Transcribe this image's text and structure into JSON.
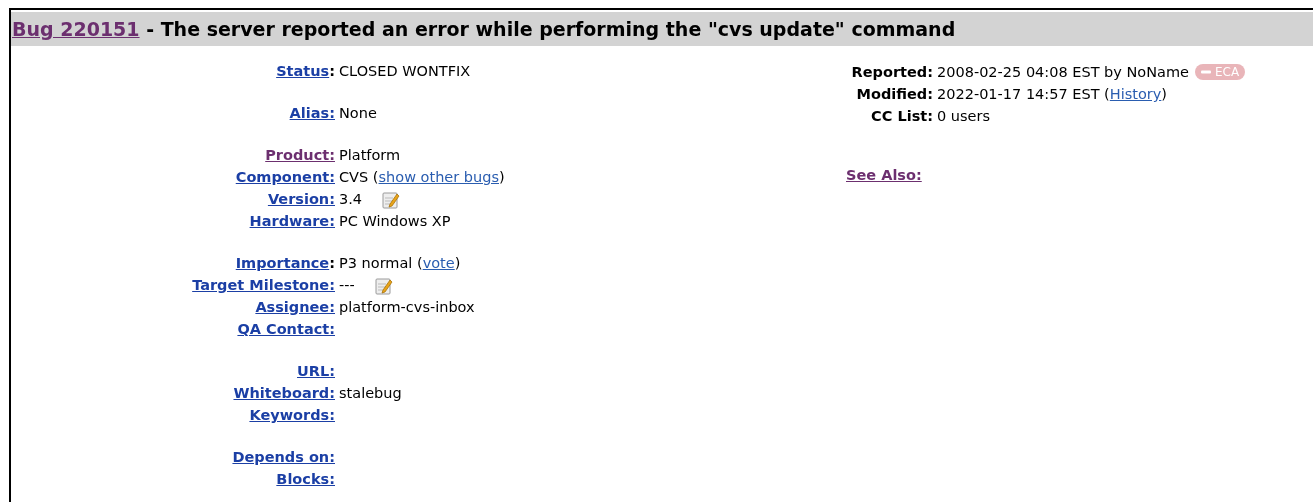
{
  "header": {
    "bug_link": "Bug 220151",
    "title": " - The server reported an error while performing the \"cvs update\" command"
  },
  "fields": [
    [
      {
        "label": "Status",
        "label_suffix": ":",
        "visited": false,
        "value": [
          {
            "kind": "text",
            "text": "CLOSED WONTFIX"
          }
        ]
      }
    ],
    [
      {
        "label": "Alias:",
        "visited": false,
        "value": [
          {
            "kind": "text",
            "text": "None"
          }
        ]
      }
    ],
    [
      {
        "label": "Product:",
        "visited": true,
        "value": [
          {
            "kind": "text",
            "text": "Platform"
          }
        ]
      },
      {
        "label": "Component:",
        "visited": false,
        "value": [
          {
            "kind": "text",
            "text": "CVS ("
          },
          {
            "kind": "link",
            "text": "show other bugs"
          },
          {
            "kind": "text",
            "text": ")"
          }
        ]
      },
      {
        "label": "Version:",
        "visited": false,
        "value": [
          {
            "kind": "text",
            "text": "3.4"
          },
          {
            "kind": "edit"
          }
        ]
      },
      {
        "label": "Hardware:",
        "visited": false,
        "value": [
          {
            "kind": "text",
            "text": "PC Windows XP"
          }
        ]
      }
    ],
    [
      {
        "label": "Importance",
        "label_suffix": ":",
        "visited": false,
        "value": [
          {
            "kind": "text",
            "text": "P3 normal ("
          },
          {
            "kind": "link",
            "text": "vote"
          },
          {
            "kind": "text",
            "text": ")"
          }
        ]
      },
      {
        "label": "Target Milestone:",
        "visited": false,
        "value": [
          {
            "kind": "text",
            "text": "---"
          },
          {
            "kind": "edit"
          }
        ]
      },
      {
        "label": "Assignee:",
        "visited": false,
        "value": [
          {
            "kind": "text",
            "text": "platform-cvs-inbox"
          }
        ]
      },
      {
        "label": "QA Contact:",
        "visited": false
      }
    ],
    [
      {
        "label": "URL:",
        "visited": false
      },
      {
        "label": "Whiteboard:",
        "visited": false,
        "value": [
          {
            "kind": "text",
            "text": "stalebug"
          }
        ]
      },
      {
        "label": "Keywords:",
        "visited": false
      }
    ],
    [
      {
        "label": "Depends on:",
        "visited": false
      },
      {
        "label": "Blocks:",
        "visited": false
      }
    ]
  ],
  "side": [
    {
      "label": "Reported:",
      "value": [
        {
          "kind": "text",
          "text": "2008-02-25 04:08 EST by NoName"
        },
        {
          "kind": "badge",
          "text": "ECA"
        }
      ]
    },
    {
      "label": "Modified:",
      "value": [
        {
          "kind": "text",
          "text": "2022-01-17 14:57 EST ("
        },
        {
          "kind": "link",
          "text": "History"
        },
        {
          "kind": "text",
          "text": ")"
        }
      ]
    },
    {
      "label": "CC List:",
      "value": [
        {
          "kind": "text",
          "text": "0 users"
        }
      ]
    }
  ],
  "see_also": {
    "label": "See Also:",
    "visited": true
  }
}
